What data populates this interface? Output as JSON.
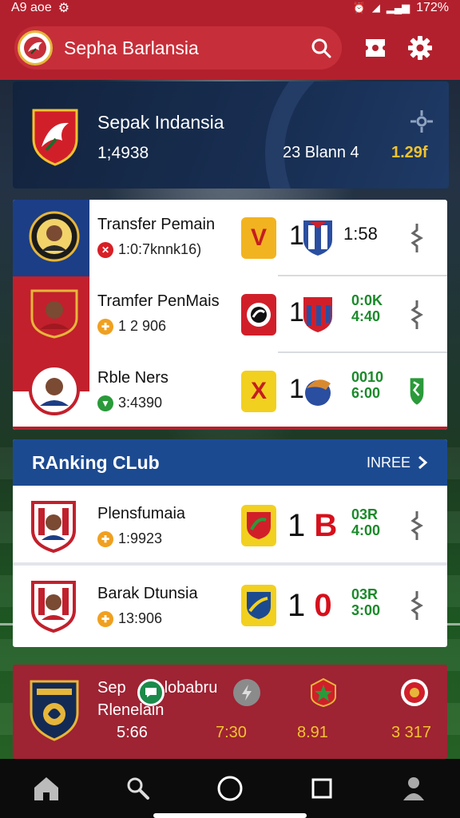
{
  "status_bar": {
    "time": "A9 aoe",
    "battery": "172%"
  },
  "app_bar": {
    "title": "Sepha Barlansia"
  },
  "hero": {
    "title": "Sepak Indansia",
    "count": "1;4938",
    "stat": "23 Blann 4",
    "value": "1.29f"
  },
  "transfers": [
    {
      "name": "Transfer Pemain",
      "sub": "1:0:7knnk16)",
      "dot_color": "#d81f26",
      "dot_glyph": "✕",
      "badge": "V",
      "score": "1",
      "time": "1:58",
      "time2": ""
    },
    {
      "name": "Tramfer PenMais",
      "sub": "1 2 906",
      "dot_color": "#f0a020",
      "dot_glyph": "✚",
      "badge": "",
      "score": "1",
      "time": "",
      "time2": "0:0K\n4:40"
    },
    {
      "name": "Rble Ners",
      "sub": "3:4390",
      "dot_color": "#2a9a3a",
      "dot_glyph": "▼",
      "badge": "X",
      "score": "1",
      "time": "",
      "time2": "0010\n6:00"
    }
  ],
  "ranking": {
    "title": "RAnking CLub",
    "more_label": "INREE",
    "rows": [
      {
        "name": "Plensfumaia",
        "sub": "1:9923",
        "score_digit": "1",
        "score_highlight": "B",
        "time2": "03R\n4:00"
      },
      {
        "name": "Barak Dtunsia",
        "sub": "13:906",
        "score_digit": "1",
        "score_highlight": "0",
        "time2": "03R\n3:00"
      }
    ]
  },
  "match": {
    "title": "Sep",
    "title_rest": "lobabru",
    "subtitle": "Rlenelain",
    "values": [
      "5:66",
      "7:30",
      "8.91",
      "3 317"
    ]
  },
  "colors": {
    "primary": "#b3202d",
    "ranking": "#1c4a91",
    "accent_yellow": "#f2c230",
    "green_time": "#1a8a2a"
  }
}
